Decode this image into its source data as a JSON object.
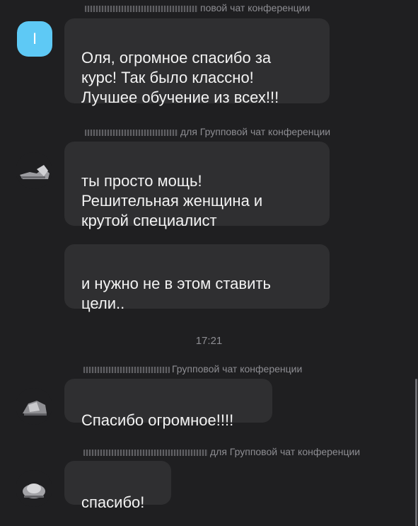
{
  "messages": [
    {
      "sender_suffix": "повой чат конференции",
      "avatar_letter": "I",
      "text": "Оля, огромное спасибо за\nкурс! Так было классно!\nЛучшее обучение из всех!!!"
    },
    {
      "sender_suffix": "для Групповой чат конференции",
      "text": "ты просто мощь!\nРешительная женщина и\nкрутой специалист"
    },
    {
      "text": "и нужно не в этом ставить\nцели.."
    },
    {
      "sender_suffix": "Групповой чат конференции",
      "text": "Спасибо огромное!!!!"
    },
    {
      "sender_suffix": "для Групповой чат конференции",
      "text": "спасибо!"
    }
  ],
  "timestamp": "17:21",
  "colors": {
    "background": "#1f1f21",
    "bubble": "#2f2f31",
    "avatar_accent": "#5ec9f5",
    "meta_text": "#8d8d92"
  }
}
